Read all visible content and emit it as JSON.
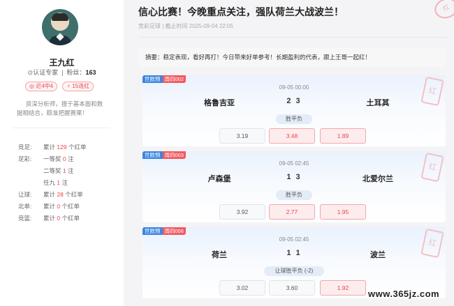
{
  "profile": {
    "name": "王九红",
    "role": "认证专家",
    "fans_label": "粉丝：",
    "fans_count": "163",
    "badge_recent": "近4中4",
    "badge_streak": "15连红",
    "intro": "资深分析师，擅于基本面和数据相结合，稳准把握赛果！",
    "stats": [
      {
        "k": "竞足:",
        "pre": "累计",
        "num": "129",
        "post": "个红单"
      },
      {
        "k": "足彩:",
        "pre": "一等奖",
        "num": "0",
        "post": "注"
      },
      {
        "k": "",
        "pre": "二等奖",
        "num": "1",
        "post": "注"
      },
      {
        "k": "",
        "pre": "任九",
        "num": "1",
        "post": "注"
      },
      {
        "k": "让球:",
        "pre": "累计",
        "num": "28",
        "post": "个红单"
      },
      {
        "k": "北单:",
        "pre": "累计",
        "num": "0",
        "post": "个红单"
      },
      {
        "k": "竞篮:",
        "pre": "累计",
        "num": "0",
        "post": "个红单"
      }
    ]
  },
  "article": {
    "title": "信心比赛！今晚重点关注，强队荷兰大战波兰！",
    "meta": "竞彩足球 | 截止时间 2025-09-04 22:05",
    "seal": "红",
    "summary": "摘要：稳定表现，看好再打！今日带来好单参考！长期盈利的代表，跟上王哥一起红！"
  },
  "matches": [
    {
      "tag1": "世欧预",
      "tag2": "周四002",
      "date": "09-05 00:00",
      "home": "格鲁吉亚",
      "score": "2 3",
      "away": "土耳其",
      "market": "胜平负",
      "odds": [
        "3.19",
        "3.48",
        "1.89"
      ],
      "selected": [
        false,
        true,
        true
      ],
      "stamp": "红"
    },
    {
      "tag1": "世欧预",
      "tag2": "周四003",
      "date": "09-05 02:45",
      "home": "卢森堡",
      "score": "1 3",
      "away": "北爱尔兰",
      "market": "胜平负",
      "odds": [
        "3.92",
        "2.77",
        "1.95"
      ],
      "selected": [
        false,
        true,
        true
      ],
      "stamp": "红"
    },
    {
      "tag1": "世欧预",
      "tag2": "周四006",
      "date": "09-05 02:45",
      "home": "荷兰",
      "score": "1 1",
      "away": "波兰",
      "market": "让球胜平负 (-2)",
      "odds": [
        "3.02",
        "3.60",
        "1.92"
      ],
      "selected": [
        false,
        false,
        true
      ],
      "stamp": "红"
    }
  ],
  "watermark": "www.365jz.com"
}
